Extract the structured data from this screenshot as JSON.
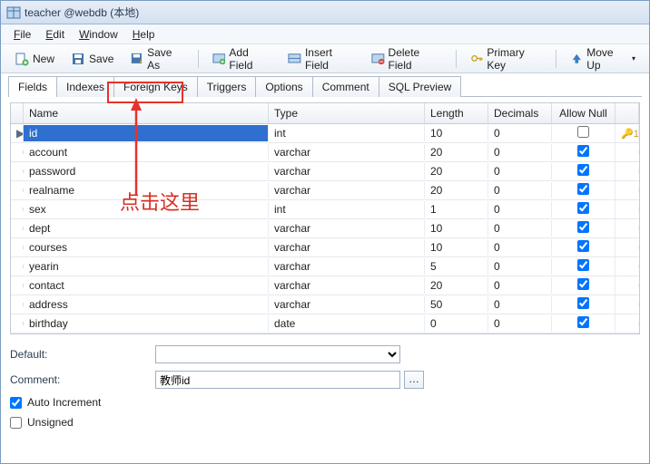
{
  "titlebar": {
    "text": "teacher @webdb (本地)"
  },
  "menu": {
    "file": "File",
    "edit": "Edit",
    "window": "Window",
    "help": "Help"
  },
  "toolbar": {
    "new": "New",
    "save": "Save",
    "save_as": "Save As",
    "add_field": "Add Field",
    "insert_field": "Insert Field",
    "delete_field": "Delete Field",
    "primary_key": "Primary Key",
    "move_up": "Move Up"
  },
  "tabs": [
    "Fields",
    "Indexes",
    "Foreign Keys",
    "Triggers",
    "Options",
    "Comment",
    "SQL Preview"
  ],
  "active_tab": "Fields",
  "grid": {
    "headers": {
      "name": "Name",
      "type": "Type",
      "length": "Length",
      "decimals": "Decimals",
      "allow_null": "Allow Null"
    },
    "rows": [
      {
        "name": "id",
        "type": "int",
        "length": "10",
        "decimals": "0",
        "allow_null": false,
        "pk": "1",
        "selected": true
      },
      {
        "name": "account",
        "type": "varchar",
        "length": "20",
        "decimals": "0",
        "allow_null": true
      },
      {
        "name": "password",
        "type": "varchar",
        "length": "20",
        "decimals": "0",
        "allow_null": true
      },
      {
        "name": "realname",
        "type": "varchar",
        "length": "20",
        "decimals": "0",
        "allow_null": true
      },
      {
        "name": "sex",
        "type": "int",
        "length": "1",
        "decimals": "0",
        "allow_null": true
      },
      {
        "name": "dept",
        "type": "varchar",
        "length": "10",
        "decimals": "0",
        "allow_null": true
      },
      {
        "name": "courses",
        "type": "varchar",
        "length": "10",
        "decimals": "0",
        "allow_null": true
      },
      {
        "name": "yearin",
        "type": "varchar",
        "length": "5",
        "decimals": "0",
        "allow_null": true
      },
      {
        "name": "contact",
        "type": "varchar",
        "length": "20",
        "decimals": "0",
        "allow_null": true
      },
      {
        "name": "address",
        "type": "varchar",
        "length": "50",
        "decimals": "0",
        "allow_null": true
      },
      {
        "name": "birthday",
        "type": "date",
        "length": "0",
        "decimals": "0",
        "allow_null": true
      }
    ]
  },
  "bottom": {
    "default_label": "Default:",
    "default_value": "",
    "comment_label": "Comment:",
    "comment_value": "教师id",
    "auto_increment_label": "Auto Increment",
    "auto_increment": true,
    "unsigned_label": "Unsigned",
    "unsigned": false
  },
  "annotation": {
    "text": "点击这里"
  }
}
